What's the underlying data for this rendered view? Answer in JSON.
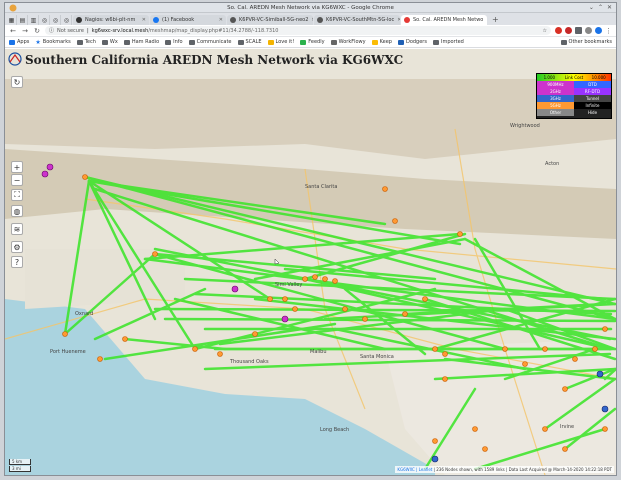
{
  "window": {
    "title": "So. Cal. AREDN Mesh Network via KG6WXC - Google Chrome"
  },
  "tabs": [
    {
      "label": "Nagios: w6bi-plt-nm",
      "fav_color": "#333333",
      "active": false
    },
    {
      "label": "(1) Facebook",
      "fav_color": "#1877f2",
      "active": false
    },
    {
      "label": "K6PVR-VC-Simiball-5G-neo2",
      "fav_color": "#555555",
      "active": false
    },
    {
      "label": "K6PVR-VC-SouthMtn-5G-loc",
      "fav_color": "#555555",
      "active": false
    },
    {
      "label": "So. Cal. AREDN Mesh Netwo",
      "fav_color": "#e53935",
      "active": true
    }
  ],
  "address": {
    "security": "Not secure",
    "host": "kg6wxc-srv.local.mesh",
    "path": "/meshmap/map_display.php#11/34.2788/-118.7310"
  },
  "bookmarks": [
    "Apps",
    "Bookmarks",
    "Tech",
    "Wx",
    "Ham Radio",
    "Info",
    "Communicate",
    "SCALE",
    "Love it!",
    "Feedly",
    "WorkFlowy",
    "Keep",
    "Dodgers",
    "Imported"
  ],
  "other_bookmarks": "Other bookmarks",
  "page": {
    "title": "Southern California AREDN Mesh Network via KG6WXC"
  },
  "controls": {
    "zoom_in": "+",
    "zoom_out": "−",
    "fullscreen": "⛶",
    "help": "?"
  },
  "legend": {
    "header": [
      "1.000",
      "Link Cost",
      "10.000"
    ],
    "rows": [
      {
        "left": "900MHz",
        "right": "DTD",
        "left_color": "#cc33cc",
        "right_color": "#3366ff"
      },
      {
        "left": "2GHz",
        "right": "RF-DTD",
        "left_color": "#cc33cc",
        "right_color": "#9933ff"
      },
      {
        "left": "3GHz",
        "right": "Tunnel",
        "left_color": "#3366cc",
        "right_color": "#444444"
      },
      {
        "left": "5GHz",
        "right": "Infinite",
        "left_color": "#ff9933",
        "right_color": "#000000"
      },
      {
        "left": "Other",
        "right": "Hide",
        "left_color": "#888888",
        "right_color": "#222222"
      }
    ]
  },
  "places": [
    "Acton",
    "Wrightwood",
    "Santa Clarita",
    "Simi Valley",
    "Thousand Oaks",
    "Oxnard",
    "Port Hueneme",
    "Malibu",
    "Santa Monica",
    "Long Beach",
    "Irvine"
  ],
  "footer": {
    "links": "KG6WXC | Leaflet",
    "stats": " | 236 Nodes shown, with 1589 links | Data Last Acquired @ March-14-2020 14:22:18 PDT"
  },
  "scale": {
    "km": "5 km",
    "mi": "3 mi"
  },
  "colors": {
    "link": "#33ee22",
    "node": "#ff9933",
    "map_bg": "#f2efe9",
    "mountain": "#d9d1c0"
  }
}
